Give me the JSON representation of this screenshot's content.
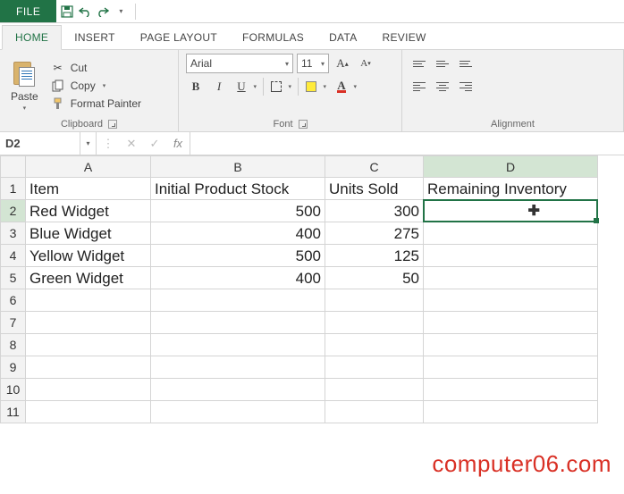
{
  "qat": {
    "file_label": "FILE"
  },
  "tabs": {
    "home": "HOME",
    "insert": "INSERT",
    "page_layout": "PAGE LAYOUT",
    "formulas": "FORMULAS",
    "data": "DATA",
    "review": "REVIEW"
  },
  "clipboard": {
    "paste": "Paste",
    "cut": "Cut",
    "copy": "Copy",
    "format_painter": "Format Painter",
    "group_label": "Clipboard"
  },
  "font": {
    "name": "Arial",
    "size": "11",
    "group_label": "Font"
  },
  "alignment": {
    "group_label": "Alignment"
  },
  "namebox": {
    "value": "D2"
  },
  "formula_bar": {
    "fx_label": "fx",
    "value": ""
  },
  "columns": [
    "A",
    "B",
    "C",
    "D"
  ],
  "rows": [
    "1",
    "2",
    "3",
    "4",
    "5",
    "6",
    "7",
    "8",
    "9",
    "10",
    "11"
  ],
  "headers": {
    "A": "Item",
    "B": "Initial Product Stock",
    "C": "Units Sold",
    "D": "Remaining Inventory"
  },
  "data_rows": [
    {
      "A": "Red Widget",
      "B": "500",
      "C": "300"
    },
    {
      "A": "Blue Widget",
      "B": "400",
      "C": "275"
    },
    {
      "A": "Yellow Widget",
      "B": "500",
      "C": "125"
    },
    {
      "A": "Green Widget",
      "B": "400",
      "C": "50"
    }
  ],
  "selected_cell": "D2",
  "watermark": "computer06.com",
  "chart_data": {
    "type": "table",
    "columns": [
      "Item",
      "Initial Product Stock",
      "Units Sold",
      "Remaining Inventory"
    ],
    "rows": [
      [
        "Red Widget",
        500,
        300,
        null
      ],
      [
        "Blue Widget",
        400,
        275,
        null
      ],
      [
        "Yellow Widget",
        500,
        125,
        null
      ],
      [
        "Green Widget",
        400,
        50,
        null
      ]
    ]
  }
}
